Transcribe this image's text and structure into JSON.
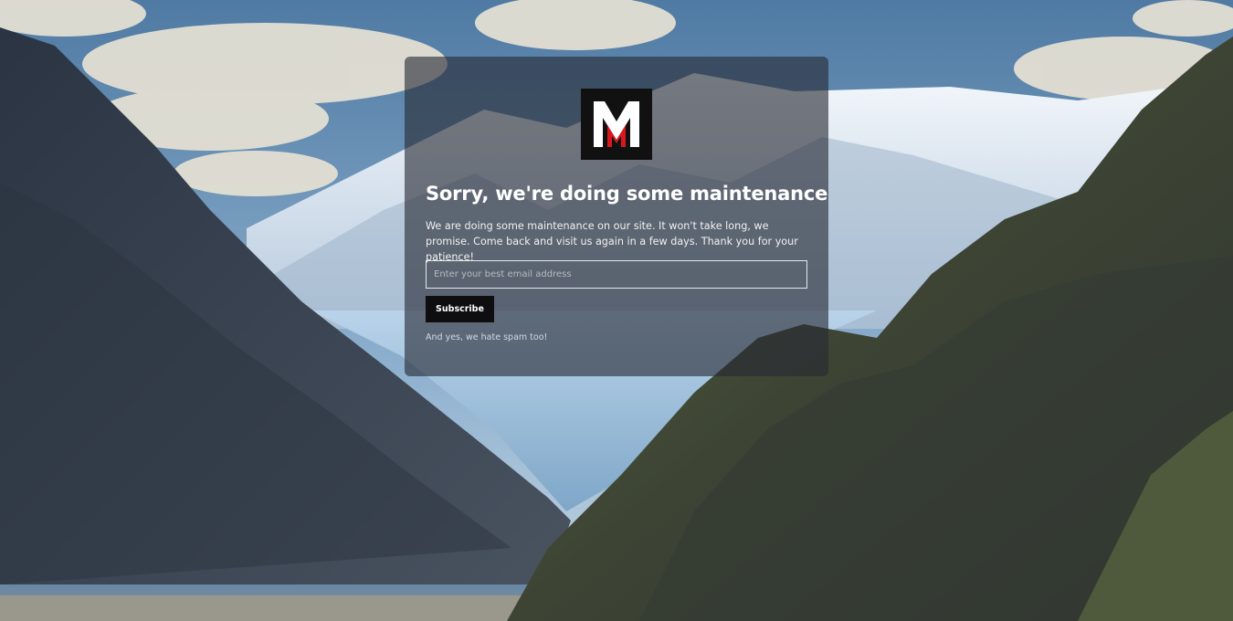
{
  "page": {
    "title": "Sorry, we're doing some maintenance",
    "description": "We are doing some maintenance on our site. It won't take long, we promise. Come back and visit us again in a few days. Thank you for your patience!",
    "note": "And yes, we hate spam too!"
  },
  "form": {
    "email_placeholder": "Enter your best email address",
    "email_value": "",
    "subscribe_label": "Subscribe"
  },
  "logo": {
    "icon": "m-logo-icon",
    "colors": {
      "background": "#111111",
      "white": "#ffffff",
      "red": "#d7191f"
    }
  },
  "colors": {
    "card_overlay": "rgba(38,42,52,0.62)",
    "button": "#0e0e10",
    "text": "#ffffff"
  }
}
